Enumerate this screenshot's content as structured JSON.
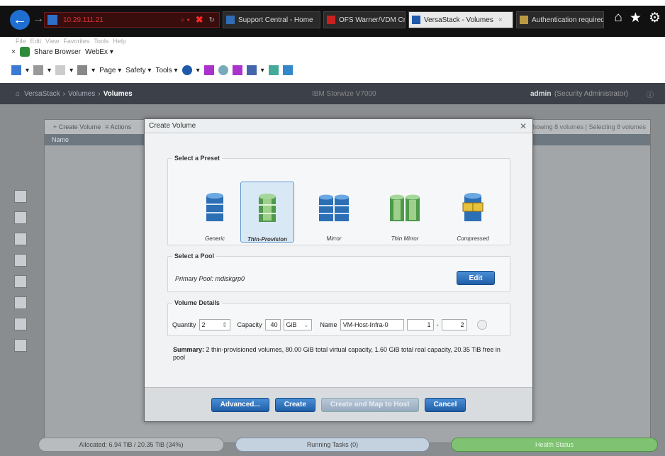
{
  "browser": {
    "address": "10.29.111.21",
    "tabs": [
      {
        "label": "Support Central - Home"
      },
      {
        "label": "OFS Warner/VDM Crest"
      },
      {
        "label": "VersaStack - Volumes"
      },
      {
        "label": "Authentication required"
      }
    ],
    "menu": [
      "File",
      "Edit",
      "View",
      "Favorites",
      "Tools",
      "Help"
    ],
    "favorites": [
      "Share Browser",
      "WebEx ▾"
    ],
    "commands": [
      "Page ▾",
      "Safety ▾",
      "Tools ▾"
    ]
  },
  "app": {
    "breadcrumb": [
      "VersaStack",
      "Volumes",
      "Volumes"
    ],
    "system_name": "IBM Storwize V7000",
    "user": "admin",
    "role": "(Security Administrator)",
    "toolbar": {
      "create_volume": "+ Create Volume",
      "actions": "≡ Actions",
      "right_text": "Showing 8 volumes | Selecting 8 volumes"
    },
    "table_header": "Name",
    "status": {
      "allocated": "Allocated: 6.94 TiB / 20.35 TiB (34%)",
      "running_tasks": "Running Tasks (0)",
      "health": "Health Status"
    }
  },
  "dialog": {
    "title": "Create Volume",
    "preset_legend": "Select a Preset",
    "presets": [
      {
        "label": "Generic"
      },
      {
        "label": "Thin-Provision"
      },
      {
        "label": "Mirror"
      },
      {
        "label": "Thin Mirror"
      },
      {
        "label": "Compressed"
      }
    ],
    "pool_legend": "Select a Pool",
    "pool_text": "Primary Pool: mdiskgrp0",
    "edit_label": "Edit",
    "details_legend": "Volume Details",
    "quantity_label": "Quantity",
    "quantity": "2",
    "capacity_label": "Capacity",
    "capacity": "40",
    "unit": "GiB",
    "name_label": "Name",
    "name_value": "VM-Host-Infra-0",
    "range_from": "1",
    "range_to": "2",
    "summary_bold": "Summary:",
    "summary_text": "2 thin-provisioned volumes, 80.00 GiB total virtual capacity, 1.60 GiB total real capacity, 20.35 TiB free in pool",
    "buttons": {
      "advanced": "Advanced...",
      "create": "Create",
      "create_map": "Create and Map to Host",
      "cancel": "Cancel"
    }
  }
}
